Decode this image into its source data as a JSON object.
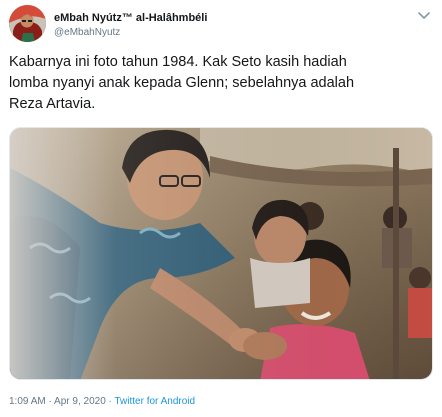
{
  "tweet": {
    "author_name": "eMbah Nyútz™ al-Halâhmbéli",
    "author_handle": "@eMbahNyutz",
    "text": "Kabarnya ini foto tahun 1984. Kak Seto kasih hadiah\nlomba nyanyi anak kepada Glenn; sebelahnya adalah\nReza Artavia.",
    "time": "1:09 AM",
    "separator": " · ",
    "date": "Apr 9, 2020",
    "source": "Twitter for Android"
  },
  "icons": {
    "menu": "chevron-down-icon"
  },
  "colors": {
    "text": "#14171a",
    "secondary": "#657786",
    "link": "#1b95e0",
    "border": "#e1e8ed"
  }
}
